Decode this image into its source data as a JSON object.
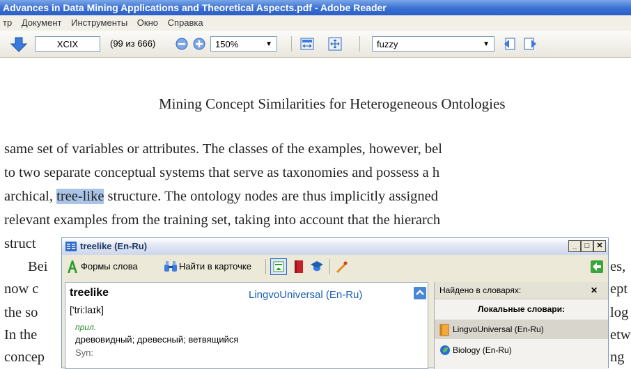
{
  "window": {
    "title": "Advances in Data Mining Applications and Theoretical Aspects.pdf - Adobe Reader"
  },
  "menu": [
    "тр",
    "Документ",
    "Инструменты",
    "Окно",
    "Справка"
  ],
  "toolbar": {
    "page_label": "XCIX",
    "page_count": "(99 из 666)",
    "zoom": "150%",
    "search": "fuzzy"
  },
  "document": {
    "heading": "Mining Concept Similarities for Heterogeneous Ontologies",
    "lines": [
      "same set of variables or attributes. The classes of the examples, however, bel",
      "to two separate conceptual systems that serve as taxonomies and possess a h",
      "archical,",
      "tree-like",
      "structure. The ontology nodes are thus implicitly assigned",
      "relevant examples from the training set, taking into account that the hierarch",
      "struct",
      "Bei",
      "now c",
      "the so",
      "In the",
      "concep"
    ],
    "right_fragments": [
      "es,",
      "ept",
      "log",
      "etw",
      "ng"
    ]
  },
  "lingvo": {
    "title": "treelike (En-Ru)",
    "forms_label": "Формы слова",
    "find_label": "Найти в карточке",
    "headword": "treelike",
    "dictionary": "LingvoUniversal (En-Ru)",
    "transcription": "['tri:laɪk]",
    "pos": "прил.",
    "translation": "древовидный; древесный; ветвящийся",
    "syn": "Syn:",
    "found_header": "Найдено в словарях:",
    "local_header": "Локальные словари:",
    "dicts": [
      "LingvoUniversal (En-Ru)",
      "Biology (En-Ru)"
    ]
  },
  "colors": {
    "titlebar": "#3a6fd2",
    "highlight": "#a9c4e6",
    "link": "#1a5fb4"
  }
}
